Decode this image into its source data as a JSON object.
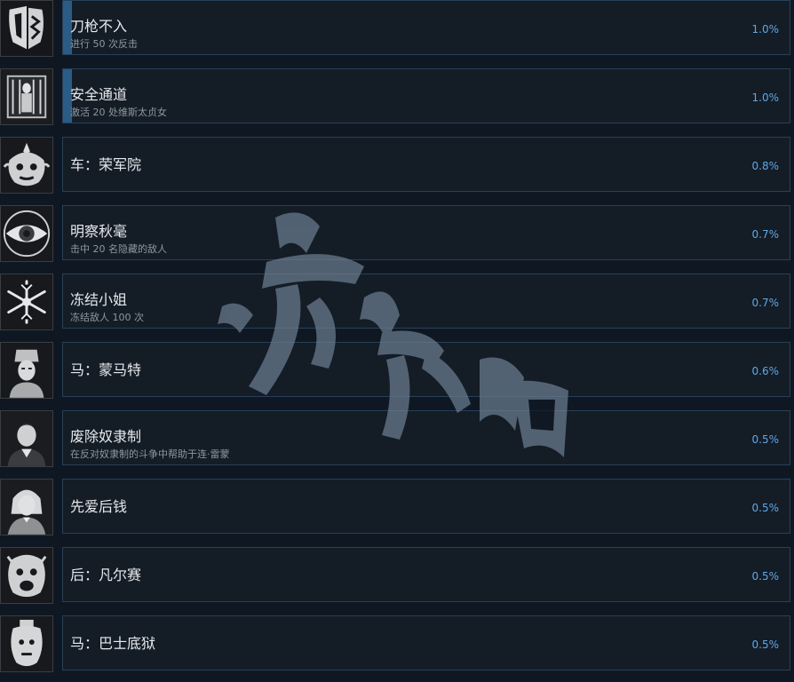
{
  "achievements": [
    {
      "title": "刀枪不入",
      "desc": "进行 50 次反击",
      "percent": "1.0%",
      "icon": "shield-sword-icon",
      "progress": 0.012
    },
    {
      "title": "安全通道",
      "desc": "激活 20 处维斯太贞女",
      "percent": "1.0%",
      "icon": "vestal-shrine-icon",
      "progress": 0.012
    },
    {
      "title": "车：荣军院",
      "desc": "",
      "percent": "0.8%",
      "icon": "ornate-mask-icon",
      "progress": 0
    },
    {
      "title": "明察秋毫",
      "desc": "击中 20 名隐藏的敌人",
      "percent": "0.7%",
      "icon": "eye-icon",
      "progress": 0
    },
    {
      "title": "冻结小姐",
      "desc": "冻结敌人 100 次",
      "percent": "0.7%",
      "icon": "snowflake-icon",
      "progress": 0
    },
    {
      "title": "马：蒙马特",
      "desc": "",
      "percent": "0.6%",
      "icon": "headdress-portrait-icon",
      "progress": 0
    },
    {
      "title": "废除奴隶制",
      "desc": "在反对奴隶制的斗争中帮助于连·雷蒙",
      "percent": "0.5%",
      "icon": "man-portrait-icon",
      "progress": 0
    },
    {
      "title": "先爱后钱",
      "desc": "",
      "percent": "0.5%",
      "icon": "powdered-wig-portrait-icon",
      "progress": 0
    },
    {
      "title": "后：凡尔赛",
      "desc": "",
      "percent": "0.5%",
      "icon": "screaming-mask-icon",
      "progress": 0
    },
    {
      "title": "马：巴士底狱",
      "desc": "",
      "percent": "0.5%",
      "icon": "fortress-mask-icon",
      "progress": 0
    }
  ],
  "watermark": "游侠网"
}
